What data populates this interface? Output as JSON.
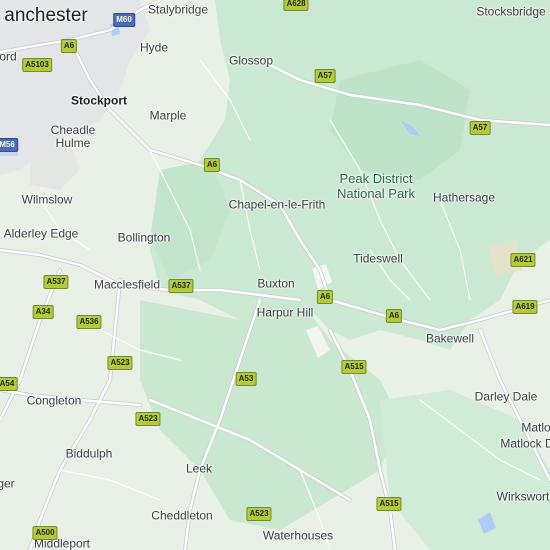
{
  "map": {
    "colors": {
      "land": "#e8efe6",
      "parkland": "#c6e8cf",
      "urban": "#e1e3e6",
      "water": "#aecbfa",
      "road": "#ffffff",
      "road_outline": "#c9ccd0",
      "highlight_a_road": "#b5c93b"
    },
    "places": [
      {
        "name": "anchester",
        "style": "big",
        "id": "manchester"
      },
      {
        "name": "Stalybridge",
        "style": "normal",
        "id": "stalybridge"
      },
      {
        "name": "Stocksbridge",
        "style": "normal",
        "id": "stocksbridge"
      },
      {
        "name": "ord",
        "style": "normal",
        "id": "stretford"
      },
      {
        "name": "Hyde",
        "style": "normal",
        "id": "hyde"
      },
      {
        "name": "Glossop",
        "style": "normal",
        "id": "glossop"
      },
      {
        "name": "Stockport",
        "style": "bold",
        "id": "stockport"
      },
      {
        "name": "Cheadle\nHulme",
        "style": "normal",
        "id": "cheadle-hulme"
      },
      {
        "name": "Marple",
        "style": "normal",
        "id": "marple"
      },
      {
        "name": "Wilmslow",
        "style": "normal",
        "id": "wilmslow"
      },
      {
        "name": "Chapel-en-le-Frith",
        "style": "normal",
        "id": "chapel-en-le-frith"
      },
      {
        "name": "Hathersage",
        "style": "normal",
        "id": "hathersage"
      },
      {
        "name": "Alderley Edge",
        "style": "normal",
        "id": "alderley-edge"
      },
      {
        "name": "Bollington",
        "style": "normal",
        "id": "bollington"
      },
      {
        "name": "Tideswell",
        "style": "normal",
        "id": "tideswell"
      },
      {
        "name": "Macclesfield",
        "style": "normal",
        "id": "macclesfield"
      },
      {
        "name": "Buxton",
        "style": "normal",
        "id": "buxton"
      },
      {
        "name": "Harpur Hill",
        "style": "normal",
        "id": "harpur-hill"
      },
      {
        "name": "Bakewell",
        "style": "normal",
        "id": "bakewell"
      },
      {
        "name": "Congleton",
        "style": "normal",
        "id": "congleton"
      },
      {
        "name": "Darley Dale",
        "style": "normal",
        "id": "darley-dale"
      },
      {
        "name": "Matlo",
        "style": "normal",
        "id": "matlock"
      },
      {
        "name": "Matlock D",
        "style": "normal",
        "id": "matlock-bath"
      },
      {
        "name": "Biddulph",
        "style": "normal",
        "id": "biddulph"
      },
      {
        "name": "Leek",
        "style": "normal",
        "id": "leek"
      },
      {
        "name": "ger",
        "style": "normal",
        "id": "kidsgrove"
      },
      {
        "name": "Wirkswort",
        "style": "normal",
        "id": "wirksworth"
      },
      {
        "name": "Cheddleton",
        "style": "normal",
        "id": "cheddleton"
      },
      {
        "name": "Waterhouses",
        "style": "normal",
        "id": "waterhouses"
      },
      {
        "name": "Middleport",
        "style": "normal",
        "id": "middleport"
      }
    ],
    "park_label": "Peak District\nNational Park",
    "road_shields": [
      {
        "label": "A628",
        "type": "a"
      },
      {
        "label": "M60",
        "type": "m"
      },
      {
        "label": "A6",
        "type": "a"
      },
      {
        "label": "A5103",
        "type": "a"
      },
      {
        "label": "A57",
        "type": "a"
      },
      {
        "label": "A57",
        "type": "a"
      },
      {
        "label": "M56",
        "type": "m"
      },
      {
        "label": "A6",
        "type": "a"
      },
      {
        "label": "A621",
        "type": "a"
      },
      {
        "label": "A537",
        "type": "a"
      },
      {
        "label": "A537",
        "type": "a"
      },
      {
        "label": "A6",
        "type": "a"
      },
      {
        "label": "A619",
        "type": "a"
      },
      {
        "label": "A34",
        "type": "a"
      },
      {
        "label": "A536",
        "type": "a"
      },
      {
        "label": "A6",
        "type": "a"
      },
      {
        "label": "A523",
        "type": "a"
      },
      {
        "label": "A515",
        "type": "a"
      },
      {
        "label": "A54",
        "type": "a"
      },
      {
        "label": "A53",
        "type": "a"
      },
      {
        "label": "A523",
        "type": "a"
      },
      {
        "label": "A523",
        "type": "a"
      },
      {
        "label": "A515",
        "type": "a"
      },
      {
        "label": "A500",
        "type": "a"
      }
    ]
  }
}
